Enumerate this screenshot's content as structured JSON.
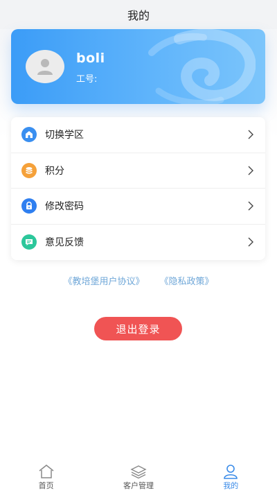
{
  "header": {
    "title": "我的"
  },
  "profile": {
    "username": "boli",
    "employee_id_label": "工号:",
    "employee_id_value": ""
  },
  "menu": {
    "items": [
      {
        "label": "切换学区",
        "icon": "campus-switch-icon",
        "color": "#3a8ff0"
      },
      {
        "label": "积分",
        "icon": "points-coins-icon",
        "color": "#f5a13a"
      },
      {
        "label": "修改密码",
        "icon": "lock-icon",
        "color": "#2f7ff0"
      },
      {
        "label": "意见反馈",
        "icon": "feedback-chat-icon",
        "color": "#2cc79b"
      }
    ]
  },
  "links": {
    "user_agreement": "《教培堡用户协议》",
    "privacy_policy": "《隐私政策》"
  },
  "logout_label": "退出登录",
  "tabbar": {
    "items": [
      {
        "label": "首页",
        "icon": "home-icon",
        "active": false
      },
      {
        "label": "客户管理",
        "icon": "layers-icon",
        "active": false
      },
      {
        "label": "我的",
        "icon": "user-icon",
        "active": true
      }
    ]
  },
  "colors": {
    "accent": "#3a8be8",
    "card_gradient_start": "#3b9cf7",
    "card_gradient_end": "#7cc5fb",
    "logout": "#f05454",
    "link": "#6fa7d8"
  }
}
